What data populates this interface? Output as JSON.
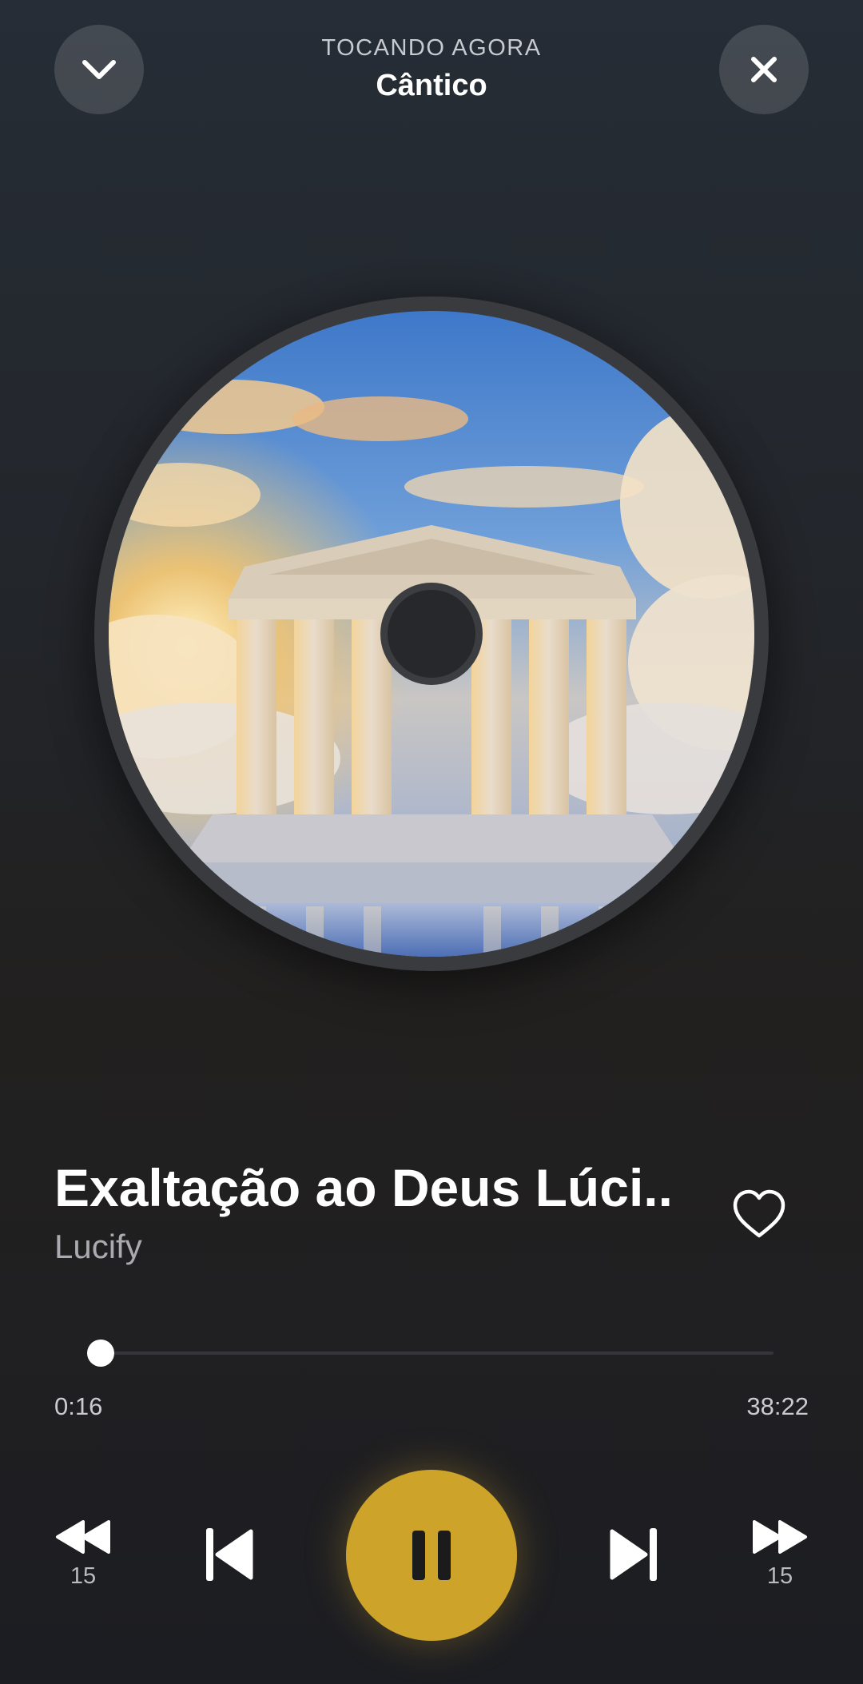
{
  "header": {
    "kicker": "TOCANDO AGORA",
    "title": "Cântico"
  },
  "track": {
    "title": "Exaltação ao Deus Lúci..",
    "artist": "Lucify",
    "elapsed": "0:16",
    "total": "38:22",
    "progress_fraction": 0.007,
    "favorited": false
  },
  "controls": {
    "rewind_seconds": "15",
    "forward_seconds": "15",
    "state": "playing"
  },
  "icons": {
    "collapse": "chevron-down-icon",
    "close": "close-icon",
    "favorite": "heart-outline-icon",
    "rewind": "rewind-15-icon",
    "previous": "skip-previous-icon",
    "pause": "pause-icon",
    "next": "skip-next-icon",
    "forward": "fast-forward-15-icon"
  },
  "colors": {
    "accent": "#cda32a",
    "background_top": "#262d36",
    "background_bottom": "#1c1d22",
    "secondary_text": "#a9abb0"
  }
}
